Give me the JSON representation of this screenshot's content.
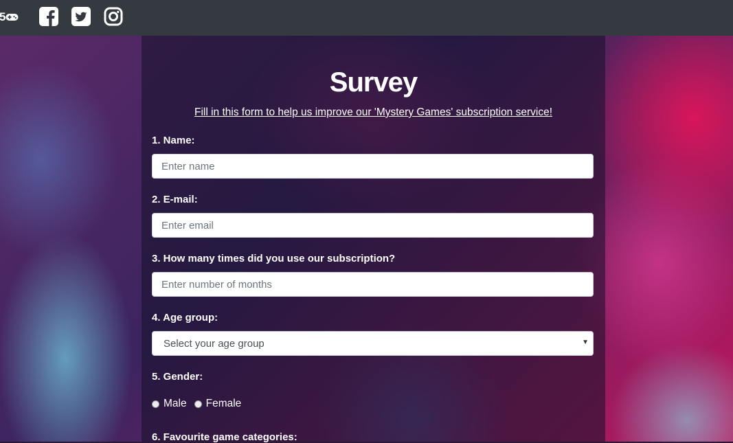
{
  "nav": {
    "brand_suffix": "5",
    "icons": [
      "gamepad-icon",
      "facebook-icon",
      "twitter-icon",
      "instagram-icon"
    ]
  },
  "form": {
    "title": "Survey",
    "subtitle": "Fill in this form to help us improve our 'Mystery Games' subscription service!",
    "fields": {
      "name": {
        "label": "1. Name:",
        "placeholder": "Enter name",
        "value": ""
      },
      "email": {
        "label": "2. E-mail:",
        "placeholder": "Enter email",
        "value": ""
      },
      "months": {
        "label": "3. How many times did you use our subscription?",
        "placeholder": "Enter number of months",
        "value": ""
      },
      "age": {
        "label": "4. Age group:",
        "selected": "Select your age group"
      },
      "gender": {
        "label": "5. Gender:",
        "options": [
          "Male",
          "Female"
        ]
      },
      "categories": {
        "label": "6. Favourite game categories:"
      }
    }
  },
  "colors": {
    "navbar": "#343a40",
    "text": "#ffffff"
  }
}
